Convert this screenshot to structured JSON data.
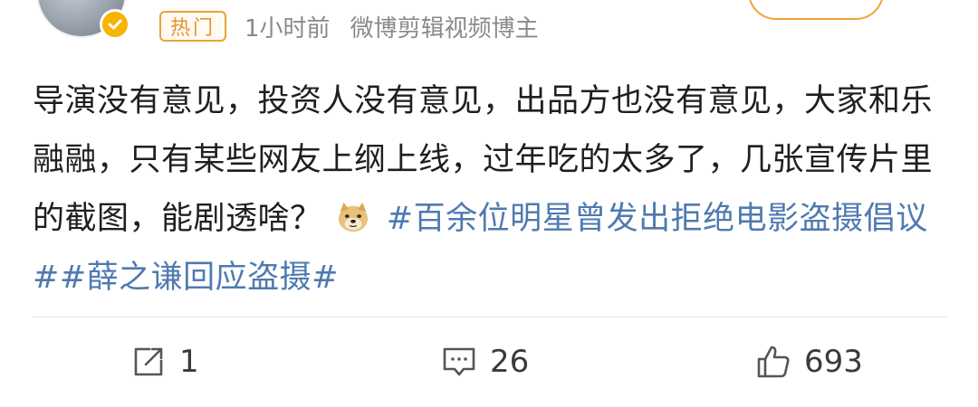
{
  "header": {
    "hot_badge": "热门",
    "time": "1小时前",
    "source": "微博剪辑视频博主"
  },
  "post": {
    "text": "导演没有意见，投资人没有意见，出品方也没有意见，大家和乐融融，只有某些网友上纲上线，过年吃的太多了，几张宣传片里的截图，能剧透啥？",
    "emoji": "doge-emoji",
    "topics": [
      "#百余位明星曾发出拒绝电影盗摄倡议#",
      "#薛之谦回应盗摄#"
    ]
  },
  "actions": {
    "repost_count": "1",
    "comment_count": "26",
    "like_count": "693"
  },
  "colors": {
    "topic": "#4f7ab0",
    "hot_badge": "#e8922a",
    "verified": "#f6b400"
  },
  "icons": [
    "verified-badge-icon",
    "doge-emoji",
    "repost-icon",
    "comment-icon",
    "like-icon"
  ]
}
